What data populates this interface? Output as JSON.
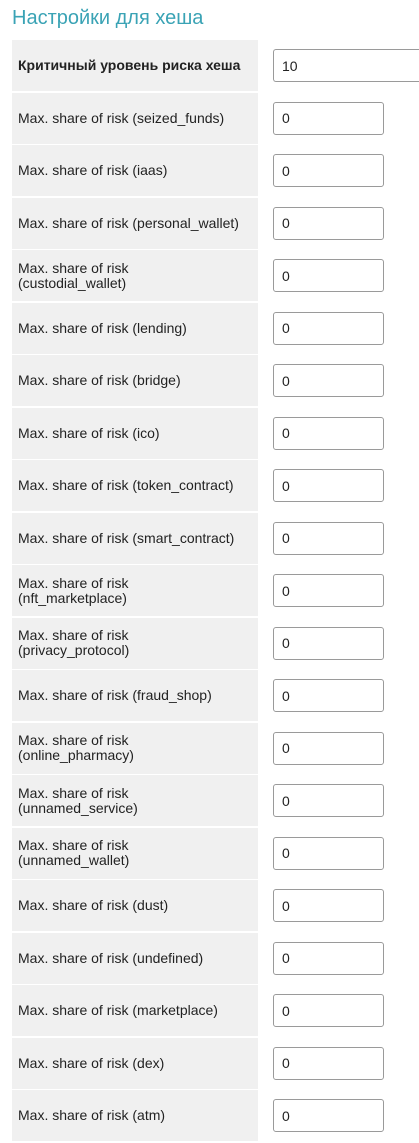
{
  "page": {
    "title": "Настройки для хеша"
  },
  "rows": [
    {
      "label": "Критичный уровень риска хеша",
      "value": "10",
      "bold": true,
      "wide": true
    },
    {
      "label": "Max. share of risk (seized_funds)",
      "value": "0"
    },
    {
      "label": "Max. share of risk (iaas)",
      "value": "0"
    },
    {
      "label": "Max. share of risk (personal_wallet)",
      "value": "0"
    },
    {
      "label": "Max. share of risk\n(custodial_wallet)",
      "value": "0"
    },
    {
      "label": "Max. share of risk (lending)",
      "value": "0"
    },
    {
      "label": "Max. share of risk (bridge)",
      "value": "0"
    },
    {
      "label": "Max. share of risk (ico)",
      "value": "0"
    },
    {
      "label": "Max. share of risk (token_contract)",
      "value": "0"
    },
    {
      "label": "Max. share of risk (smart_contract)",
      "value": "0"
    },
    {
      "label": "Max. share of risk\n(nft_marketplace)",
      "value": "0"
    },
    {
      "label": "Max. share of risk\n(privacy_protocol)",
      "value": "0"
    },
    {
      "label": "Max. share of risk (fraud_shop)",
      "value": "0"
    },
    {
      "label": "Max. share of risk\n(online_pharmacy)",
      "value": "0"
    },
    {
      "label": "Max. share of risk\n(unnamed_service)",
      "value": "0"
    },
    {
      "label": "Max. share of risk\n(unnamed_wallet)",
      "value": "0"
    },
    {
      "label": "Max. share of risk (dust)",
      "value": "0"
    },
    {
      "label": "Max. share of risk (undefined)",
      "value": "0"
    },
    {
      "label": "Max. share of risk (marketplace)",
      "value": "0"
    },
    {
      "label": "Max. share of risk (dex)",
      "value": "0"
    },
    {
      "label": "Max. share of risk (atm)",
      "value": "0"
    }
  ],
  "colors": {
    "title": "#3aa3b5",
    "label_background": "#f0f0f0",
    "input_border": "#9a9a9a"
  }
}
